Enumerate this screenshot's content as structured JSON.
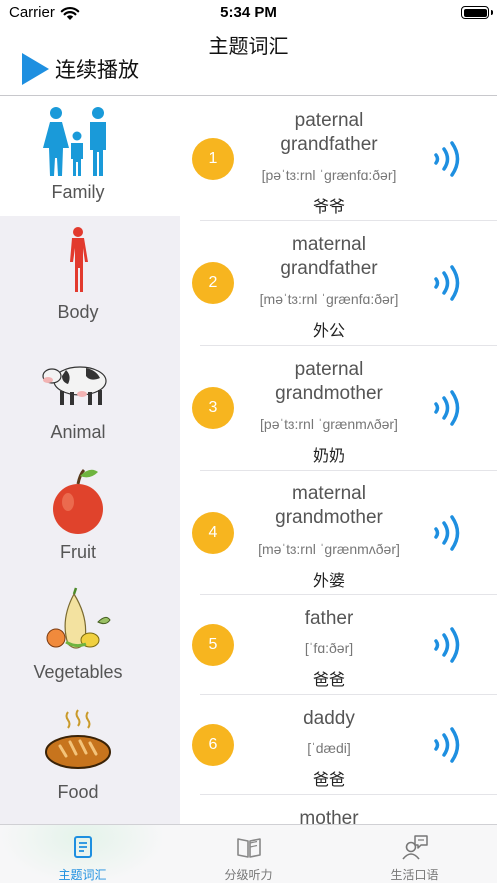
{
  "status": {
    "carrier": "Carrier",
    "time": "5:34 PM"
  },
  "nav": {
    "title": "主题词汇",
    "play_label": "连续播放"
  },
  "colors": {
    "accent": "#1e8fe0",
    "badge": "#f7b51f",
    "sidebar_bg": "#f0eff4"
  },
  "categories": [
    {
      "label": "Family",
      "icon": "family-icon",
      "active": true
    },
    {
      "label": "Body",
      "icon": "body-icon"
    },
    {
      "label": "Animal",
      "icon": "cow-icon"
    },
    {
      "label": "Fruit",
      "icon": "apple-icon"
    },
    {
      "label": "Vegetables",
      "icon": "vegetables-icon"
    },
    {
      "label": "Food",
      "icon": "bread-icon"
    }
  ],
  "words": [
    {
      "num": "1",
      "en_line1": "paternal",
      "en_line2": "grandfather",
      "ipa": "[pəˈtɜ:rnl ˈɡrænfɑ:ðər]",
      "zh": "爷爷"
    },
    {
      "num": "2",
      "en_line1": "maternal",
      "en_line2": "grandfather",
      "ipa": "[məˈtɜ:rnl ˈɡrænfɑ:ðər]",
      "zh": "外公"
    },
    {
      "num": "3",
      "en_line1": "paternal",
      "en_line2": "grandmother",
      "ipa": "[pəˈtɜ:rnl ˈɡrænmʌðər]",
      "zh": "奶奶"
    },
    {
      "num": "4",
      "en_line1": "maternal",
      "en_line2": "grandmother",
      "ipa": "[məˈtɜ:rnl ˈɡrænmʌðər]",
      "zh": "外婆"
    },
    {
      "num": "5",
      "en_line1": "father",
      "en_line2": "",
      "ipa": "[ˈfɑ:ðər]",
      "zh": "爸爸"
    },
    {
      "num": "6",
      "en_line1": "daddy",
      "en_line2": "",
      "ipa": "[ˈdædi]",
      "zh": "爸爸"
    },
    {
      "num": "7",
      "en_line1": "mother",
      "en_line2": "",
      "ipa": "",
      "zh": ""
    }
  ],
  "tabs": [
    {
      "label": "主题词汇",
      "icon": "vocabulary-icon",
      "active": true
    },
    {
      "label": "分级听力",
      "icon": "book-icon"
    },
    {
      "label": "生活口语",
      "icon": "speaking-icon"
    }
  ]
}
